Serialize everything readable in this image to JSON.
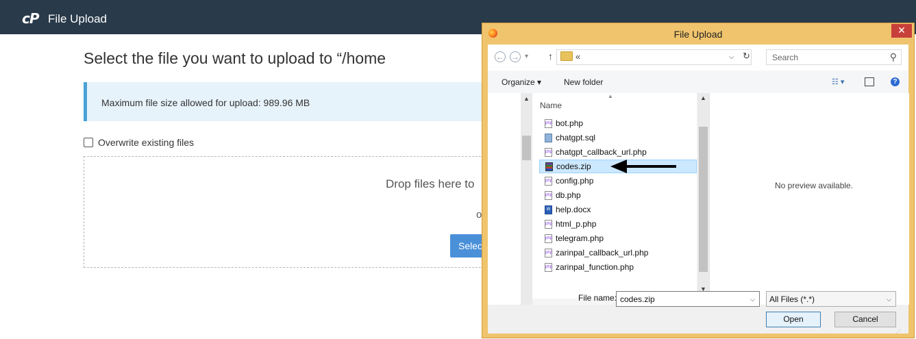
{
  "app": {
    "logo_text": "cP",
    "title": "File Upload"
  },
  "page": {
    "heading": "Select the file you want to upload to “/home",
    "info": "Maximum file size allowed for upload: 989.96 MB",
    "overwrite_label": "Overwrite existing files",
    "drop_text": "Drop files here to",
    "or_text": "o",
    "select_button": "Selec"
  },
  "dialog": {
    "title": "File Upload",
    "close": "✕",
    "breadcrumb": "«",
    "search_placeholder": "Search",
    "organize_label": "Organize ▾",
    "new_folder_label": "New folder",
    "column_header": "Name",
    "files": [
      {
        "name": "bot.php",
        "type": "php"
      },
      {
        "name": "chatgpt.sql",
        "type": "sql"
      },
      {
        "name": "chatgpt_callback_url.php",
        "type": "php"
      },
      {
        "name": "codes.zip",
        "type": "zip",
        "selected": true
      },
      {
        "name": "config.php",
        "type": "php"
      },
      {
        "name": "db.php",
        "type": "php"
      },
      {
        "name": "help.docx",
        "type": "docx"
      },
      {
        "name": "html_p.php",
        "type": "php"
      },
      {
        "name": "telegram.php",
        "type": "php"
      },
      {
        "name": "zarinpal_callback_url.php",
        "type": "php"
      },
      {
        "name": "zarinpal_function.php",
        "type": "php"
      }
    ],
    "preview_text": "No preview available.",
    "filename_label": "File name:",
    "filename_value": "codes.zip",
    "filetype_value": "All Files (*.*)",
    "open_button": "Open",
    "cancel_button": "Cancel"
  },
  "colors": {
    "header_bg": "#293a4a",
    "info_accent": "#4aa2d6",
    "button_blue": "#4a90d9",
    "dialog_frame": "#f0c46d",
    "close_red": "#c8403a",
    "selection": "#cce8ff"
  }
}
